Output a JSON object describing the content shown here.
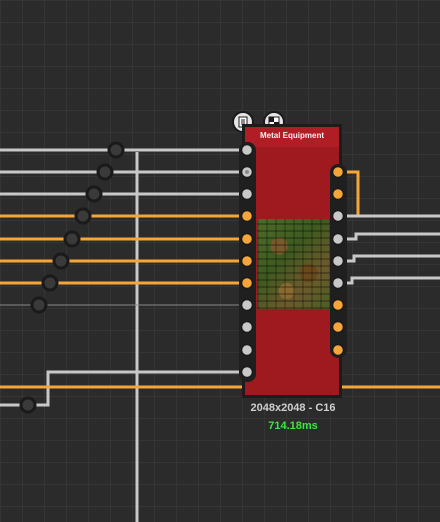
{
  "node": {
    "title": "Metal Equipment",
    "resolution_label": "2048x2048 - C16",
    "cook_time_label": "714.18ms",
    "thumbnail": "metal-equipment-texture-preview",
    "icons": [
      "document-icon",
      "checker-icon"
    ]
  },
  "colors": {
    "background": "#2b2b2b",
    "node_body": "#9e1a1f",
    "node_header": "#b11d24",
    "wire_orange": "#f5a53a",
    "wire_gray": "#c8c8c8",
    "time_green": "#3ee63e"
  }
}
